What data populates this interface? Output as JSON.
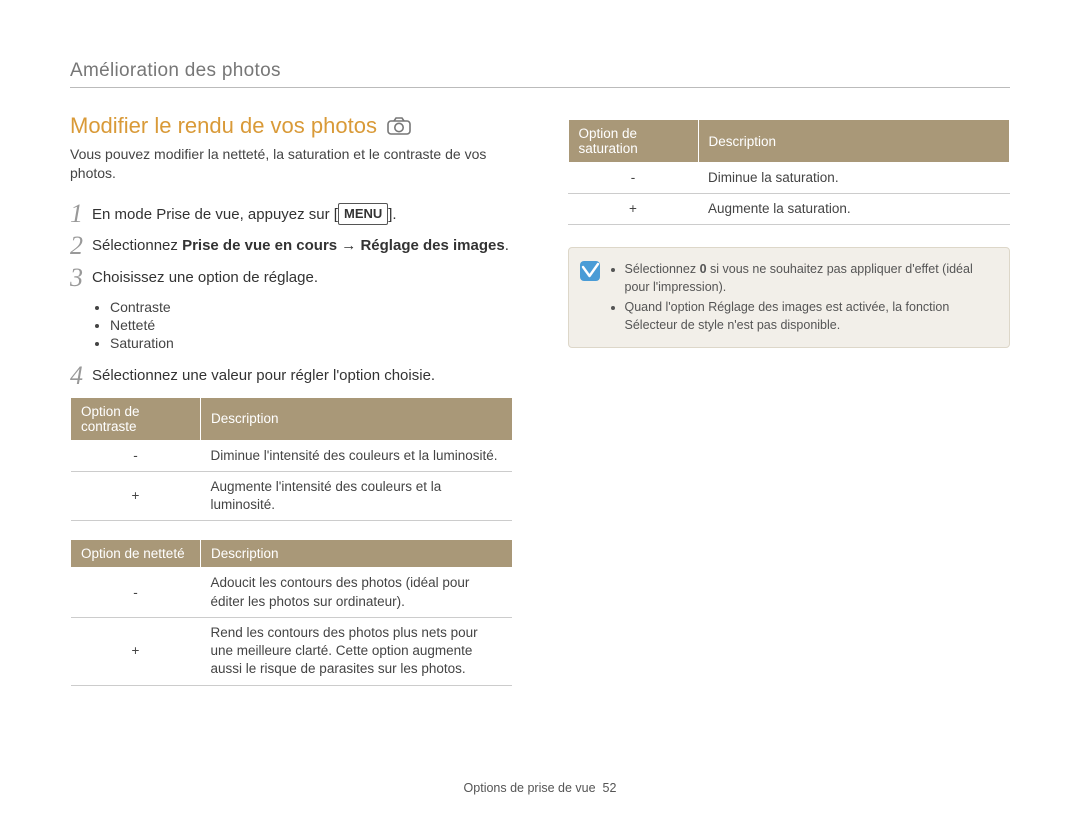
{
  "breadcrumb": "Amélioration des photos",
  "section": {
    "title": "Modifier le rendu de vos photos",
    "icon": "camera-icon",
    "intro": "Vous pouvez modifier la netteté, la saturation et le contraste de vos photos."
  },
  "steps": {
    "1": {
      "num": "1",
      "pre": "En mode Prise de vue, appuyez sur [",
      "kbd": "MENU",
      "post": "]."
    },
    "2": {
      "num": "2",
      "text_a": "Sélectionnez ",
      "bold": "Prise de vue en cours → Réglage des images",
      "text_b": "."
    },
    "3": {
      "num": "3",
      "text": "Choisissez une option de réglage."
    },
    "4": {
      "num": "4",
      "text": "Sélectionnez une valeur pour régler l'option choisie."
    }
  },
  "step3_bullets": [
    "Contraste",
    "Netteté",
    "Saturation"
  ],
  "tables": {
    "contrast": {
      "headers": [
        "Option de contraste",
        "Description"
      ],
      "rows": [
        {
          "sym": "-",
          "desc": "Diminue l'intensité des couleurs et la luminosité."
        },
        {
          "sym": "+",
          "desc": "Augmente l'intensité des couleurs et la luminosité."
        }
      ]
    },
    "sharpness": {
      "headers": [
        "Option de netteté",
        "Description"
      ],
      "rows": [
        {
          "sym": "-",
          "desc": "Adoucit les contours des photos (idéal pour éditer les photos sur ordinateur)."
        },
        {
          "sym": "+",
          "desc": "Rend les contours des photos plus nets pour une meilleure clarté. Cette option augmente aussi le risque de parasites sur les photos."
        }
      ]
    },
    "saturation": {
      "headers": [
        "Option de saturation",
        "Description"
      ],
      "rows": [
        {
          "sym": "-",
          "desc": "Diminue la saturation."
        },
        {
          "sym": "+",
          "desc": "Augmente la saturation."
        }
      ]
    }
  },
  "note": {
    "items": [
      {
        "pre": "Sélectionnez ",
        "bold": "0",
        "post": " si vous ne souhaitez pas appliquer d'effet (idéal pour l'impression)."
      },
      {
        "text": "Quand l'option Réglage des images est activée, la fonction Sélecteur de style n'est pas disponible."
      }
    ]
  },
  "footer": {
    "section": "Options de prise de vue",
    "page": "52"
  }
}
